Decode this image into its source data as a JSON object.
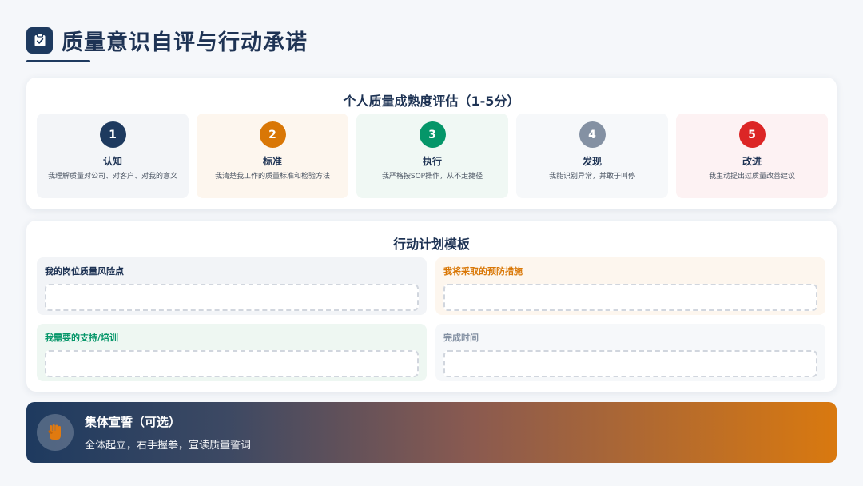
{
  "header": {
    "title": "质量意识自评与行动承诺",
    "icon": "clipboard-check-icon"
  },
  "maturity": {
    "title": "个人质量成熟度评估（1-5分）",
    "levels": [
      {
        "num": "1",
        "name": "认知",
        "desc": "我理解质量对公司、对客户、对我的意义",
        "color": "#1e3a5f",
        "bg": "#f3f5f8"
      },
      {
        "num": "2",
        "name": "标准",
        "desc": "我清楚我工作的质量标准和检验方法",
        "color": "#d97706",
        "bg": "#fdf6ee"
      },
      {
        "num": "3",
        "name": "执行",
        "desc": "我严格按SOP操作，从不走捷径",
        "color": "#059669",
        "bg": "#f0f8f4"
      },
      {
        "num": "4",
        "name": "发现",
        "desc": "我能识别异常，并敢于叫停",
        "color": "#8491a3",
        "bg": "#f6f8fa"
      },
      {
        "num": "5",
        "name": "改进",
        "desc": "我主动提出过质量改善建议",
        "color": "#dc2626",
        "bg": "#fdf2f3"
      }
    ]
  },
  "plan": {
    "title": "行动计划模板",
    "fields": [
      {
        "label": "我的岗位质量风险点",
        "color": "#1e3354",
        "bg": "#f2f4f7"
      },
      {
        "label": "我将采取的预防措施",
        "color": "#d97706",
        "bg": "#fdf6ee"
      },
      {
        "label": "我需要的支持/培训",
        "color": "#059669",
        "bg": "#eef7f2"
      },
      {
        "label": "完成时间",
        "color": "#8491a3",
        "bg": "#f6f8fa"
      }
    ]
  },
  "pledge": {
    "title": "集体宣誓（可选）",
    "subtitle": "全体起立，右手握拳，宣读质量誓词",
    "icon": "raised-fist-icon"
  }
}
